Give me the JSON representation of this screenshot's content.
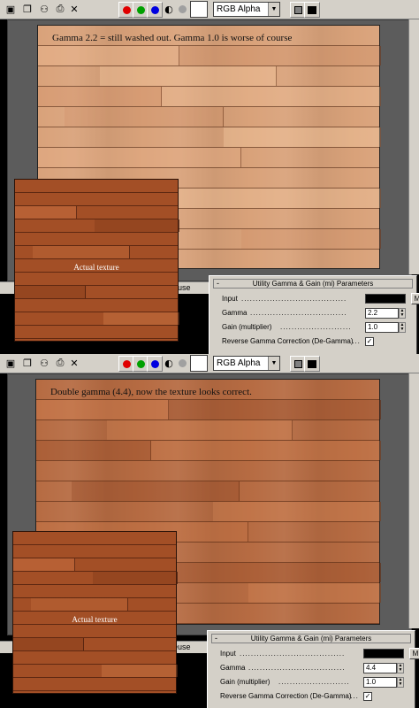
{
  "toolbar": {
    "channel_value": "RGB Alpha",
    "icons": [
      "save-icon",
      "copy-icon",
      "compare-icon",
      "print-icon",
      "close-icon"
    ],
    "close_glyph": "✕",
    "colors": {
      "red": "#e00000",
      "green": "#00a000",
      "blue": "#0000e0",
      "mono": "#303030",
      "alpha": "#a0a0a0"
    }
  },
  "top": {
    "caption": "Gamma 2.2 = still washed out.  Gamma 1.0 is worse of course",
    "texture_label": "Actual texture",
    "status_text": "euse",
    "panel": {
      "title": "Utility Gamma & Gain (mi) Parameters",
      "minus": "-",
      "input_label": "Input",
      "input_button": "M",
      "gamma_label": "Gamma",
      "gamma_value": "2.2",
      "gain_label": "Gain (multiplier)",
      "gain_value": "1.0",
      "degamma_label": "Reverse Gamma Correction (De-Gamma)",
      "degamma_checked": "✓"
    }
  },
  "bottom": {
    "caption": "Double gamma (4.4), now the texture looks correct.",
    "texture_label": "Actual texture",
    "status_text": "euse",
    "panel": {
      "title": "Utility Gamma & Gain (mi) Parameters",
      "minus": "-",
      "input_label": "Input",
      "input_button": "M",
      "gamma_label": "Gamma",
      "gamma_value": "4.4",
      "gain_label": "Gain (multiplier)",
      "gain_value": "1.0",
      "degamma_label": "Reverse Gamma Correction (De-Gamma)",
      "degamma_checked": "✓"
    }
  }
}
